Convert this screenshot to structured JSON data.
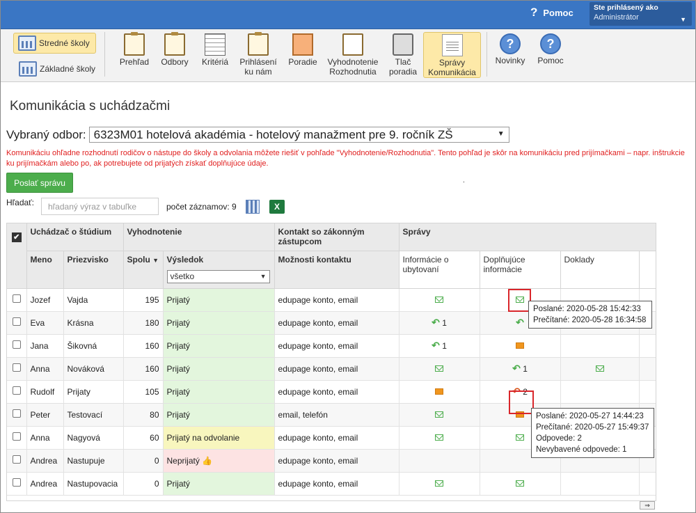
{
  "header": {
    "help_label": "Pomoc",
    "logged_in_as": "Ste prihlásený ako",
    "user_role": "Administrátor"
  },
  "school_tabs": [
    {
      "label": "Stredné školy",
      "active": true
    },
    {
      "label": "Základné školy",
      "active": false
    }
  ],
  "toolbar": [
    {
      "label": "Prehľad",
      "icon": "clipboard-eye-icon"
    },
    {
      "label": "Odbory",
      "icon": "clipboard-search-icon"
    },
    {
      "label": "Kritériá",
      "icon": "grid-filter-icon"
    },
    {
      "label": "Prihlásení ku nám",
      "icon": "clipboard-check-icon"
    },
    {
      "label": "Poradie",
      "icon": "orange-warning-icon"
    },
    {
      "label": "Vyhodnotenie Rozhodnutia",
      "icon": "certificate-icon"
    },
    {
      "label": "Tlač poradia",
      "icon": "printer-icon"
    },
    {
      "label": "Správy Komunikácia",
      "icon": "document-icon",
      "active": true
    },
    {
      "label": "Novinky",
      "icon": "question-circle-icon"
    },
    {
      "label": "Pomoc",
      "icon": "question-circle-icon"
    }
  ],
  "page_title": "Komunikácia s uchádzačmi",
  "odbor": {
    "label": "Vybraný odbor:",
    "selected": "6323M01 hotelová akadémia - hotelový manažment pre 9. ročník ZŠ"
  },
  "warning_text": "Komunikáciu ohľadne rozhodnutí rodičov o nástupe do školy a odvolania môžete riešiť v pohľade \"Vyhodnotenie/Rozhodnutia\". Tento pohľad je skôr na komunikáciu pred prijímačkami – napr. inštrukcie ku prijímačkám alebo po, ak potrebujete od prijatých získať doplňujúce údaje.",
  "send_button": "Poslať správu",
  "dot": ".",
  "search": {
    "label": "Hľadať:",
    "placeholder": "hľadaný výraz v tabuľke"
  },
  "record_count": "počet záznamov: 9",
  "excel_label": "X",
  "table": {
    "group_headers": {
      "applicant": "Uchádzač o štúdium",
      "evaluation": "Vyhodnotenie",
      "contact": "Kontakt so zákonným zástupcom",
      "messages": "Správy"
    },
    "columns": {
      "first": "Meno",
      "last": "Priezvisko",
      "total": "Spolu",
      "sort_marker": "▼",
      "result": "Výsledok",
      "result_filter": "všetko",
      "contact_options": "Možnosti kontaktu",
      "accommodation": "Informácie o ubytovaní",
      "additional": "Doplňujúce informácie",
      "documents": "Doklady"
    },
    "rows": [
      {
        "first": "Jozef",
        "last": "Vajda",
        "total": "195",
        "result": "Prijatý",
        "status": "green",
        "contact": "edupage konto, email",
        "acc": "env",
        "acc_text": "",
        "add": "env",
        "add_text": "",
        "doc": "",
        "doc_text": ""
      },
      {
        "first": "Eva",
        "last": "Krásna",
        "total": "180",
        "result": "Prijatý",
        "status": "green",
        "contact": "edupage konto, email",
        "acc": "reply",
        "acc_text": "1",
        "add": "reply",
        "add_text": "",
        "doc": "envo",
        "doc_text": ""
      },
      {
        "first": "Jana",
        "last": "Šikovná",
        "total": "160",
        "result": "Prijatý",
        "status": "green",
        "contact": "edupage konto, email",
        "acc": "reply",
        "acc_text": "1",
        "add": "envo",
        "add_text": "",
        "doc": "",
        "doc_text": ""
      },
      {
        "first": "Anna",
        "last": "Nováková",
        "total": "160",
        "result": "Prijatý",
        "status": "green",
        "contact": "edupage konto, email",
        "acc": "env",
        "acc_text": "",
        "add": "reply",
        "add_text": "1",
        "doc": "env",
        "doc_text": ""
      },
      {
        "first": "Rudolf",
        "last": "Prijaty",
        "total": "105",
        "result": "Prijatý",
        "status": "green",
        "contact": "edupage konto, email",
        "acc": "envo",
        "acc_text": "",
        "add": "replyred",
        "add_text": "2",
        "doc": "",
        "doc_text": ""
      },
      {
        "first": "Peter",
        "last": "Testovací",
        "total": "80",
        "result": "Prijatý",
        "status": "green",
        "contact": "email, telefón",
        "acc": "env",
        "acc_text": "",
        "add": "envo",
        "add_text": "",
        "doc": "",
        "doc_text": ""
      },
      {
        "first": "Anna",
        "last": "Nagyová",
        "total": "60",
        "result": "Prijatý na odvolanie",
        "status": "yellow",
        "contact": "edupage konto, email",
        "acc": "env",
        "acc_text": "",
        "add": "env",
        "add_text": "",
        "doc": "",
        "doc_text": ""
      },
      {
        "first": "Andrea",
        "last": "Nastupuje",
        "total": "0",
        "result": "Neprijatý",
        "status": "red",
        "contact": "edupage konto, email",
        "acc": "",
        "acc_text": "",
        "add": "",
        "add_text": "",
        "doc": "",
        "doc_text": ""
      },
      {
        "first": "Andrea",
        "last": "Nastupovacia",
        "total": "0",
        "result": "Prijatý",
        "status": "green",
        "contact": "edupage konto, email",
        "acc": "env",
        "acc_text": "",
        "add": "env",
        "add_text": "",
        "doc": "",
        "doc_text": ""
      }
    ]
  },
  "tooltip1": {
    "sent": "Poslané: 2020-05-28 15:42:33",
    "read": "Prečítané: 2020-05-28 16:34:58"
  },
  "tooltip2": {
    "sent": "Poslané: 2020-05-27 14:44:23",
    "read": "Prečítané: 2020-05-27 15:49:37",
    "replies": "Odpovede: 2",
    "unresolved": "Nevybavené odpovede: 1"
  },
  "scroll_label": "⇒"
}
